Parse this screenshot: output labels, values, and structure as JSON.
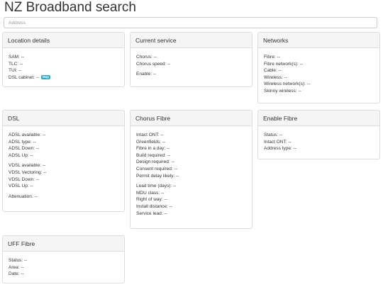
{
  "page": {
    "title": "NZ Broadband search",
    "search": {
      "placeholder": "Address",
      "value": ""
    }
  },
  "panels": {
    "location": {
      "title": "Location details",
      "rows": [
        "SAM: --",
        "TLC: --",
        "TUI: --",
        "DSL cabinet: --"
      ],
      "map_badge": "Map"
    },
    "current_service": {
      "title": "Current service",
      "rows": [
        "Chorus: --",
        "Chorus speed: --"
      ],
      "rows2": [
        "Enable: --"
      ]
    },
    "networks": {
      "title": "Networks",
      "rows": [
        "Fibre: --",
        "Fibre network(s): --",
        "Cable: --",
        "Wireless: --",
        "Wireless network(s): --",
        "Skinny wireless: --"
      ]
    },
    "dsl": {
      "title": "DSL",
      "rows": [
        "ADSL available: --",
        "ADSL type: --",
        "ADSL Down: --",
        "ADSL Up: --"
      ],
      "rows2": [
        "VDSL available: --",
        "VDSL Vectoring: --",
        "VDSL Down: --",
        "VDSL Up: --"
      ],
      "rows3": [
        "Attenuation: --"
      ]
    },
    "chorus_fibre": {
      "title": "Chorus Fibre",
      "rows": [
        "Intact ONT: --",
        "Greenfields: --",
        "Fibre in a day: --",
        "Build required: --",
        "Design required: --",
        "Consent required: --",
        "Permit delay likely: --"
      ],
      "rows2": [
        "Lead time (days): --",
        "MDU class: --",
        "Right of way: --",
        "Install distance: --",
        "Service lead: --"
      ]
    },
    "enable_fibre": {
      "title": "Enable Fibre",
      "rows": [
        "Status: --",
        "Intact ONT: --",
        "Address type: --"
      ]
    },
    "uff_fibre": {
      "title": "UFF Fibre",
      "rows": [
        "Status: --",
        "Area: --",
        "Date: --"
      ]
    }
  }
}
